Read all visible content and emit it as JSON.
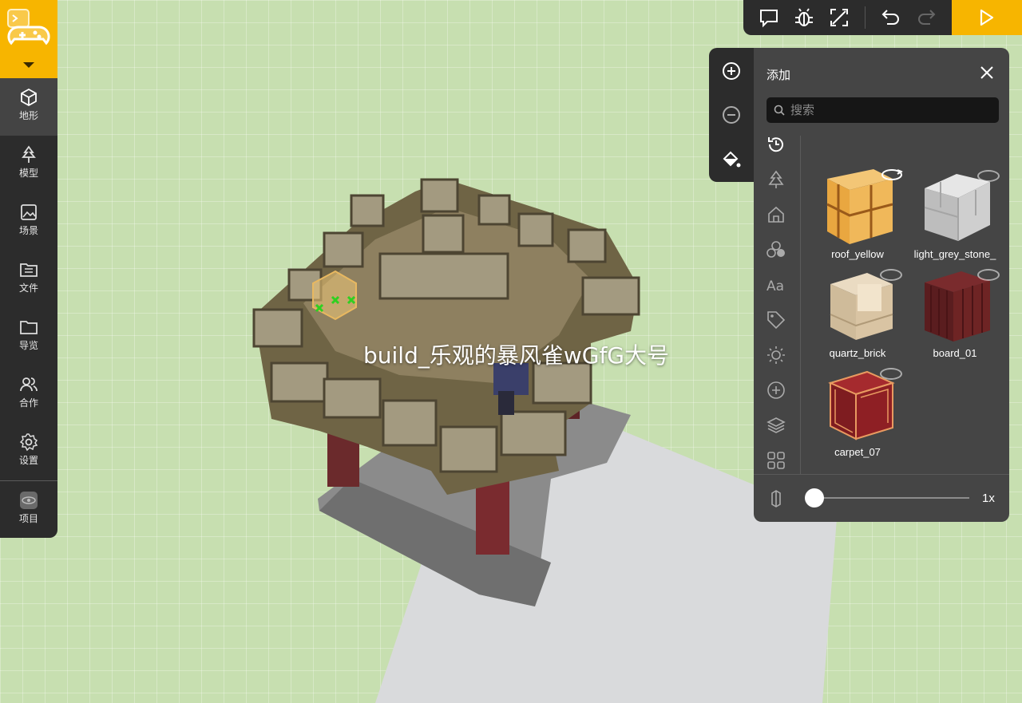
{
  "world": {
    "label": "build_乐观的暴风雀wGfG大号"
  },
  "sidebar": {
    "logo_icon": "gamepad-icon",
    "items": [
      {
        "label": "地形",
        "icon": "cube-icon"
      },
      {
        "label": "模型",
        "icon": "tree-icon"
      },
      {
        "label": "场景",
        "icon": "image-icon"
      },
      {
        "label": "文件",
        "icon": "folder-list-icon"
      },
      {
        "label": "导览",
        "icon": "folder-icon"
      },
      {
        "label": "合作",
        "icon": "users-icon"
      },
      {
        "label": "设置",
        "icon": "gear-icon"
      },
      {
        "label": "项目",
        "icon": "project-icon"
      }
    ]
  },
  "toolbar": {
    "icons": [
      "comment-icon",
      "bug-icon",
      "fullscreen-icon",
      "undo-icon",
      "redo-icon",
      "play-icon"
    ]
  },
  "panel": {
    "title": "添加",
    "search_placeholder": "搜索",
    "mini_tools": [
      "add-circle-icon",
      "remove-circle-icon",
      "paint-bucket-icon"
    ],
    "categories": [
      "history-icon",
      "tree-icon",
      "house-icon",
      "spheres-icon",
      "text-icon",
      "tag-icon",
      "sun-icon",
      "plus-circle-icon",
      "layers-icon",
      "grid-icon"
    ],
    "items": [
      {
        "name": "roof_yellow",
        "color": "#e8a842"
      },
      {
        "name": "light_grey_stone_",
        "color": "#c9c9c9"
      },
      {
        "name": "quartz_brick",
        "color": "#d9c4a3"
      },
      {
        "name": "board_01",
        "color": "#6e2424"
      },
      {
        "name": "carpet_07",
        "color": "#8e1f24"
      }
    ],
    "scale_value": "1x"
  },
  "colors": {
    "accent": "#f7b500",
    "sidebar": "#2c2c2c",
    "panel": "#454545"
  }
}
